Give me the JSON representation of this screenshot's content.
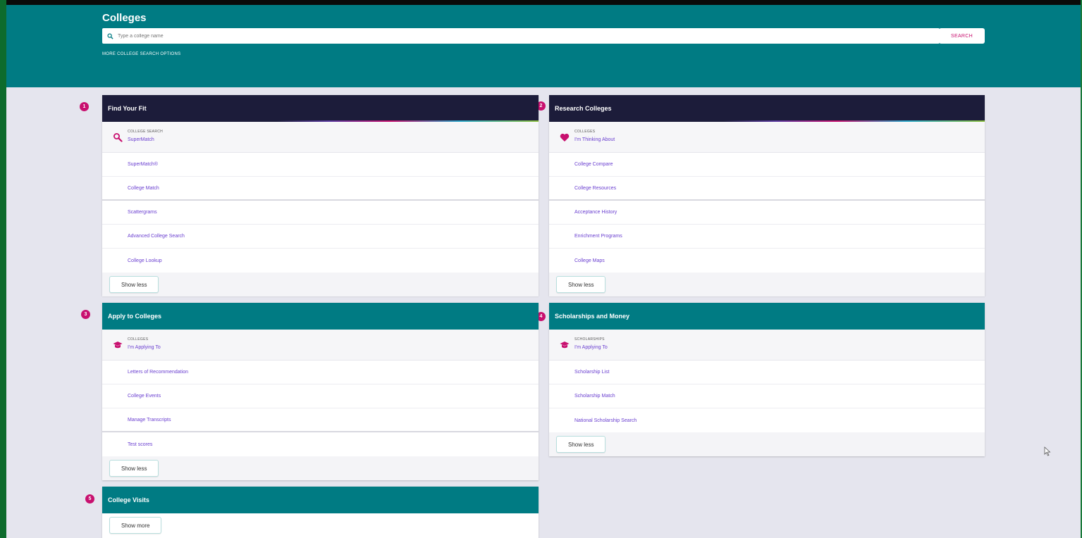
{
  "header": {
    "title": "Colleges",
    "search_placeholder": "Type a college name",
    "search_button": "SEARCH",
    "more_options": "MORE COLLEGE SEARCH OPTIONS"
  },
  "sections": {
    "find_your_fit": {
      "number": "1",
      "title": "Find Your Fit",
      "featured_label": "COLLEGE SEARCH",
      "featured_link": "SuperMatch",
      "links": [
        "SuperMatch®",
        "College Match",
        "Scattergrams",
        "Advanced College Search",
        "College Lookup"
      ],
      "toggle": "Show less"
    },
    "research_colleges": {
      "number": "2",
      "title": "Research Colleges",
      "featured_label": "COLLEGES",
      "featured_link": "I'm Thinking About",
      "links": [
        "College Compare",
        "College Resources",
        "Acceptance History",
        "Enrichment Programs",
        "College Maps"
      ],
      "toggle": "Show less"
    },
    "apply_to_colleges": {
      "number": "3",
      "title": "Apply to Colleges",
      "featured_label": "COLLEGES",
      "featured_link": "I'm Applying To",
      "links": [
        "Letters of Recommendation",
        "College Events",
        "Manage Transcripts",
        "Test scores"
      ],
      "toggle": "Show less"
    },
    "scholarships": {
      "number": "4",
      "title": "Scholarships and Money",
      "featured_label": "SCHOLARSHIPS",
      "featured_link": "I'm Applying To",
      "links": [
        "Scholarship List",
        "Scholarship Match",
        "National Scholarship Search"
      ],
      "toggle": "Show less"
    },
    "college_visits": {
      "number": "5",
      "title": "College Visits",
      "toggle": "Show more"
    }
  },
  "colors": {
    "teal": "#007b83",
    "navy": "#1c1c3a",
    "accent": "#c8106f",
    "link": "#6a3fd0"
  },
  "icons": {
    "search": "search-icon",
    "heart": "heart-icon",
    "graduation_cap": "graduation-cap-icon",
    "cursor": "mouse-pointer-icon"
  }
}
